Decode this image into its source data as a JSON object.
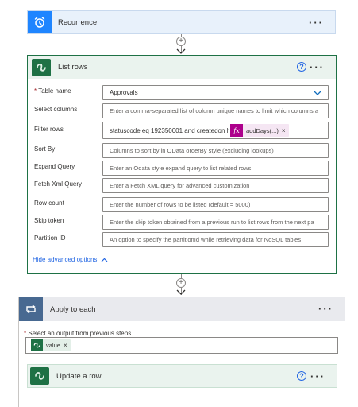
{
  "recurrence": {
    "title": "Recurrence",
    "more": "···"
  },
  "list_rows": {
    "title": "List rows",
    "help": "?",
    "more": "···",
    "fields": [
      {
        "label": "Table name",
        "required": "*",
        "value": "Approvals",
        "placeholder": ""
      },
      {
        "label": "Select columns",
        "value": "",
        "placeholder": "Enter a comma-separated list of column unique names to limit which columns a"
      },
      {
        "label": "Filter rows",
        "value": "statuscode eq 192350001 and createdon lt",
        "token": "addDays(...)",
        "token_close": "×",
        "placeholder": ""
      },
      {
        "label": "Sort By",
        "value": "",
        "placeholder": "Columns to sort by in OData orderBy style (excluding lookups)"
      },
      {
        "label": "Expand Query",
        "value": "",
        "placeholder": "Enter an Odata style expand query to list related rows"
      },
      {
        "label": "Fetch Xml Query",
        "value": "",
        "placeholder": "Enter a Fetch XML query for advanced customization"
      },
      {
        "label": "Row count",
        "value": "",
        "placeholder": "Enter the number of rows to be listed (default = 5000)"
      },
      {
        "label": "Skip token",
        "value": "",
        "placeholder": "Enter the skip token obtained from a previous run to list rows from the next pa"
      },
      {
        "label": "Partition ID",
        "value": "",
        "placeholder": "An option to specify the partitionId while retrieving data for NoSQL tables"
      }
    ],
    "advanced_link": "Hide advanced options"
  },
  "apply_to_each": {
    "title": "Apply to each",
    "more": "···",
    "output_label": "Select an output from previous steps",
    "required": "*",
    "token": "value",
    "token_close": "×"
  },
  "update_row": {
    "title": "Update a row",
    "help": "?",
    "more": "···"
  },
  "colors": {
    "recurrence_header": "#e8f1fb",
    "recurrence_icon": "#1f85ff",
    "dataverse_green": "#1e7145",
    "list_rows_header": "#eaf3ee",
    "apply_header": "#e9eaee",
    "apply_icon": "#486991",
    "expression_pink": "#ad008c",
    "link_blue": "#2266e3"
  }
}
